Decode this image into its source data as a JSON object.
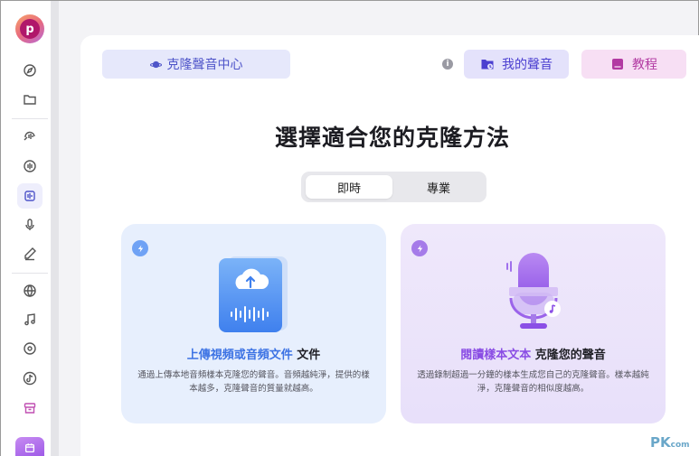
{
  "sidebar": {
    "avatar_letter": "p",
    "icons": [
      "compass-icon",
      "folder-icon",
      "voice-changer-icon",
      "audio-wave-icon",
      "voice-clone-icon",
      "microphone-icon",
      "pen-icon",
      "globe-icon",
      "music-note-icon",
      "disc-icon",
      "tiktok-icon",
      "archive-icon",
      "calendar-icon"
    ]
  },
  "header": {
    "center_label": "克隆聲音中心",
    "info_symbol": "i",
    "my_voice_label": "我的聲音",
    "tutorial_label": "教程"
  },
  "main": {
    "title": "選擇適合您的克隆方法",
    "toggle": {
      "selected": "即時",
      "other": "專業"
    },
    "cards": [
      {
        "title_accent": "上傳視頻或音頻文件",
        "title_rest": " 文件",
        "description": "通過上傳本地音頻樣本克隆您的聲音。音頻越純淨，提供的樣本越多，克隆聲音的質量就越高。"
      },
      {
        "title_accent": "閱讀樣本文本",
        "title_rest": " 克隆您的聲音",
        "description": "透過錄制超過一分鐘的樣本生成您自己的克隆聲音。樣本越純淨，克隆聲音的相似度越高。"
      }
    ]
  },
  "watermark": {
    "text": "PK",
    "small": "com"
  },
  "colors": {
    "accent_indigo": "#4f55c9",
    "accent_blue": "#3d73e4",
    "accent_purple": "#8a4de4",
    "tutorial_pink": "#b23aa2"
  }
}
